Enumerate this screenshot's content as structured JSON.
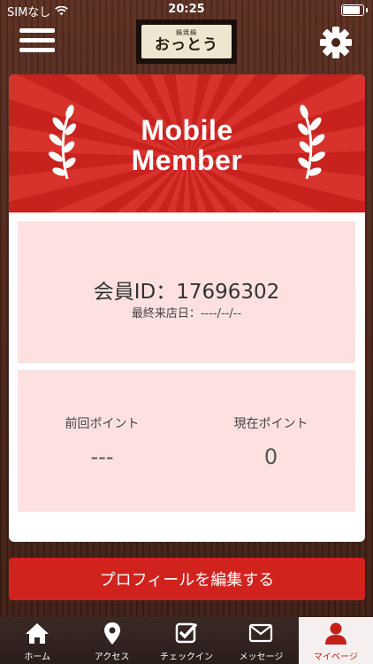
{
  "status_bar": {
    "carrier": "SIMなし",
    "time": "20:25"
  },
  "header": {
    "logo_sub": "鍋焼鍋",
    "logo_main": "おっとう",
    "logo_small": ""
  },
  "banner": {
    "line1": "Mobile",
    "line2": "Member"
  },
  "member": {
    "id_label": "会員ID：17696302",
    "last_visit": "最終来店日：----/--/--"
  },
  "points": {
    "previous": {
      "label": "前回ポイント",
      "value": "---"
    },
    "current": {
      "label": "現在ポイント",
      "value": "0"
    }
  },
  "profile_button": "プロフィールを編集する",
  "tabs": [
    {
      "label": "ホーム",
      "icon": "home-icon"
    },
    {
      "label": "アクセス",
      "icon": "map-pin-icon"
    },
    {
      "label": "チェックイン",
      "icon": "checkin-icon"
    },
    {
      "label": "メッセージ",
      "icon": "mail-icon"
    },
    {
      "label": "マイページ",
      "icon": "user-icon"
    }
  ],
  "colors": {
    "accent": "#d2221e",
    "panel": "#fde1e1",
    "wood": "#4a2418"
  }
}
